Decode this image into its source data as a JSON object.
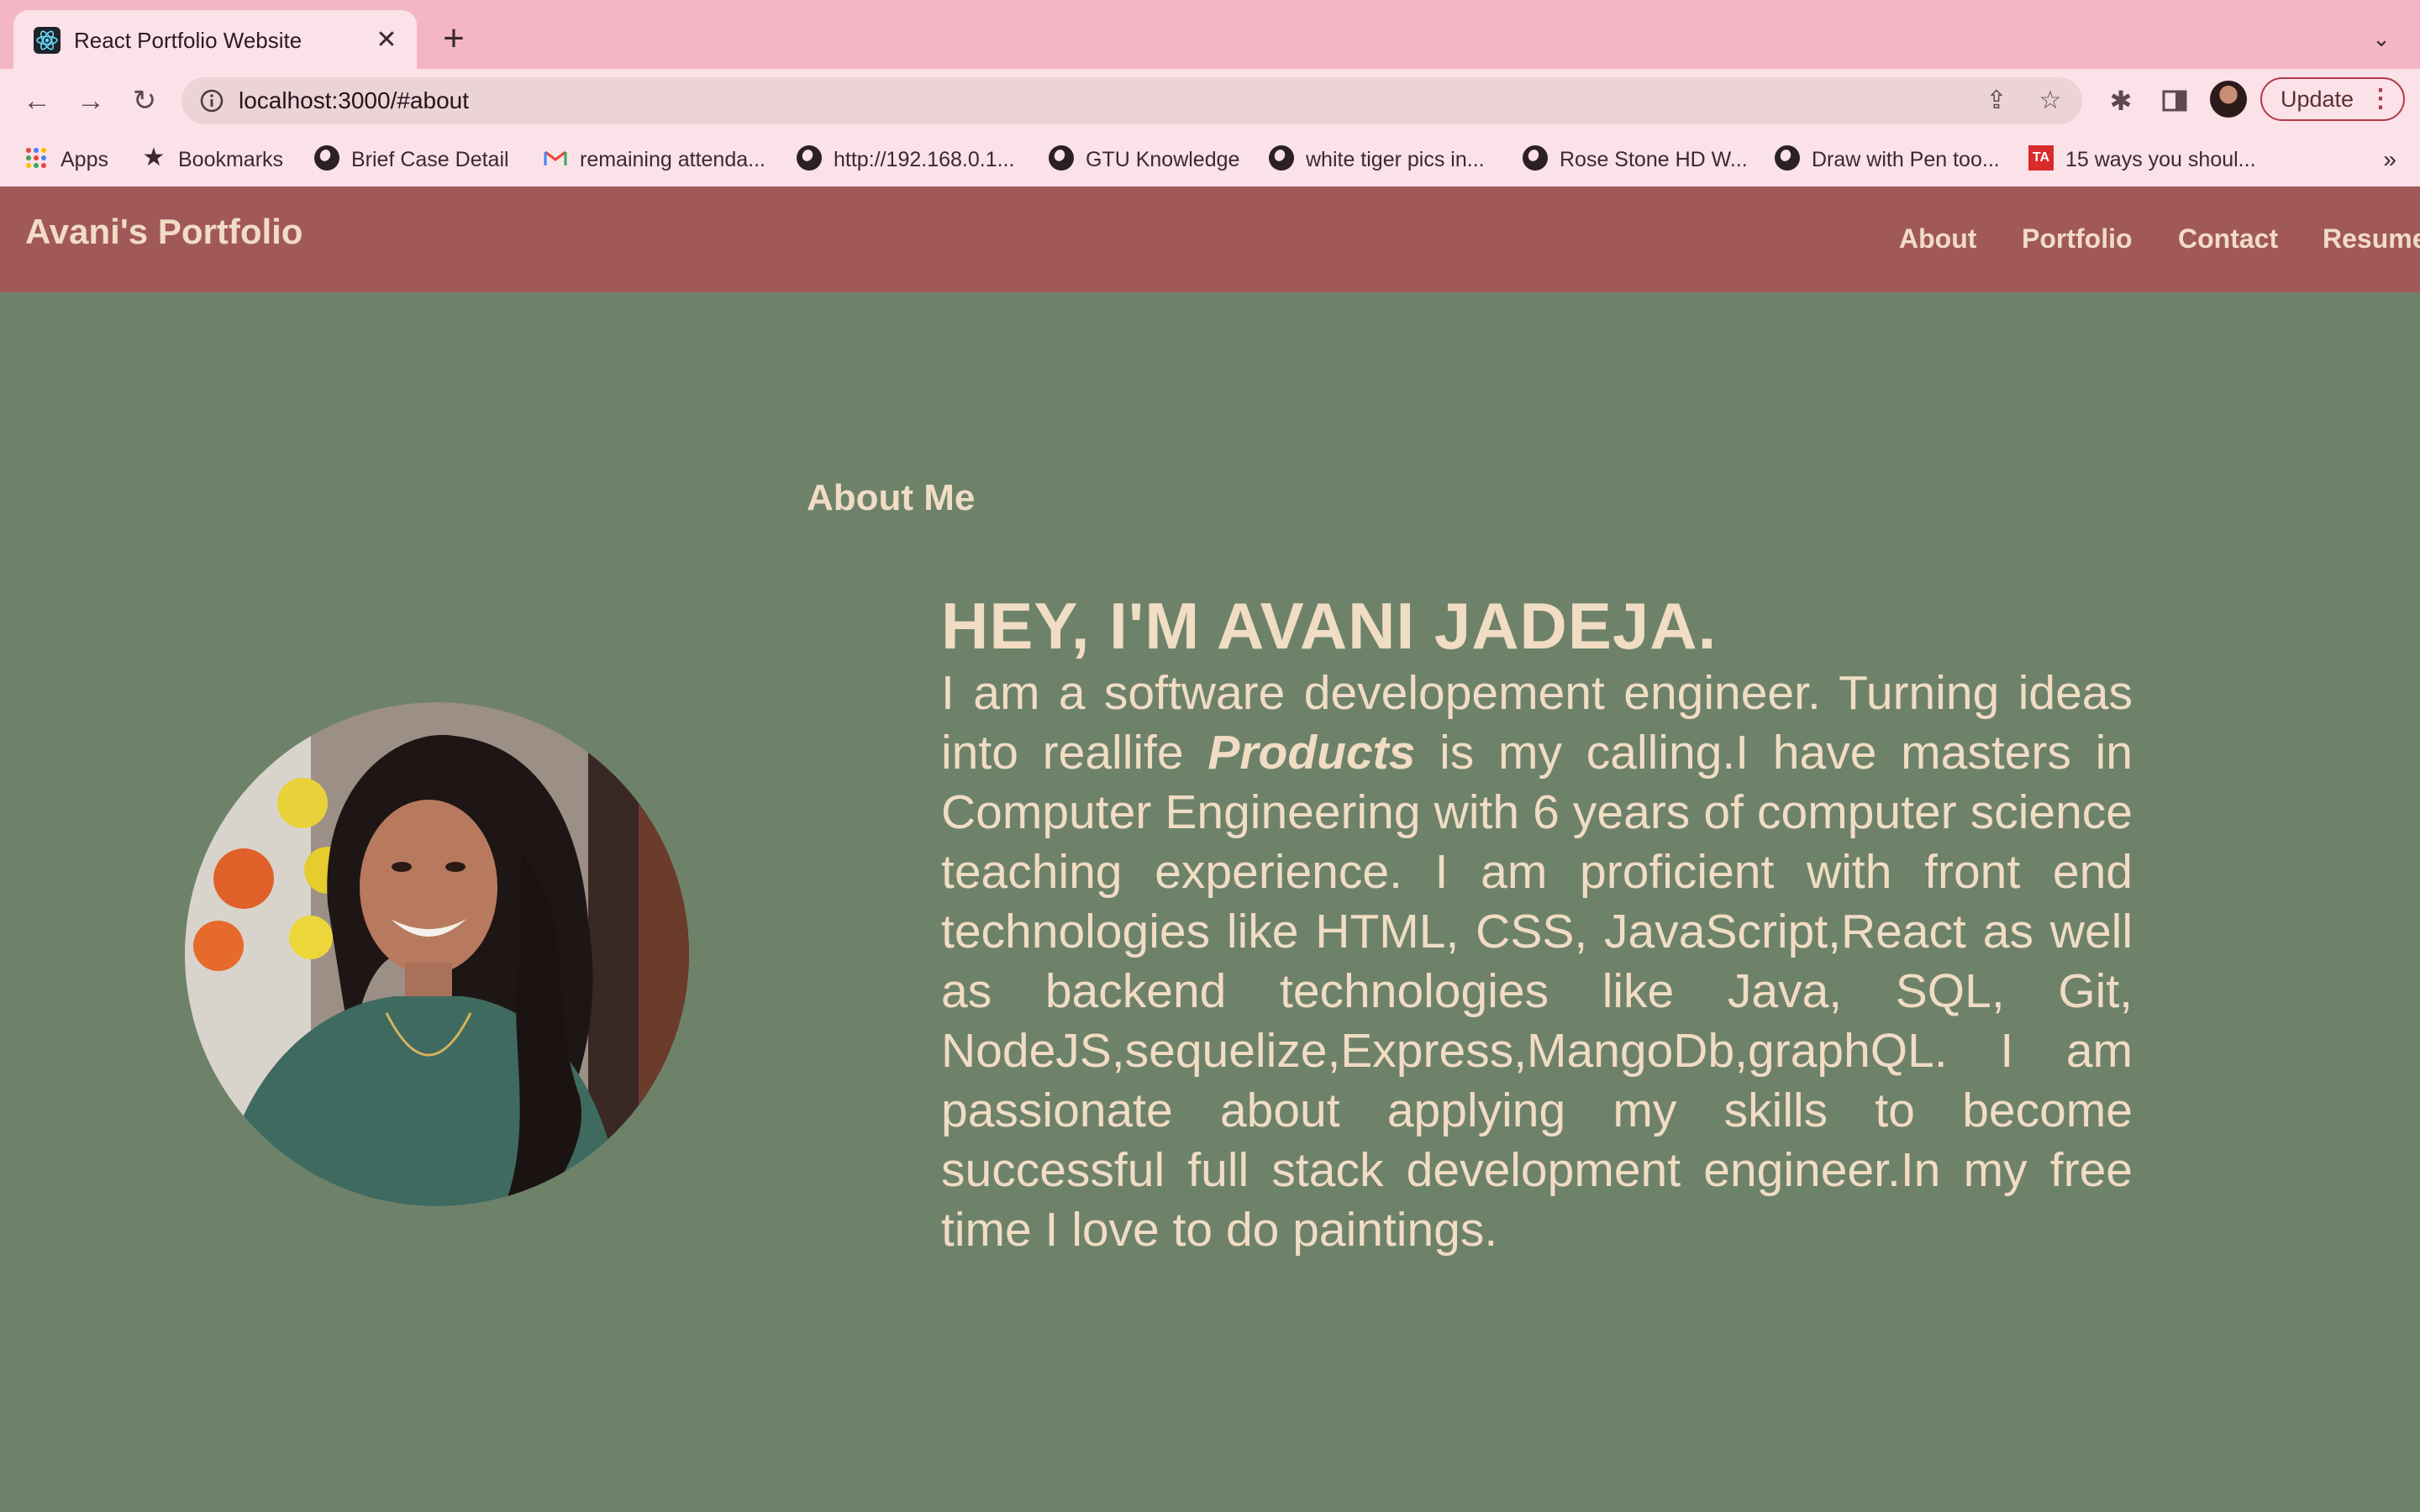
{
  "browser": {
    "tab": {
      "title": "React Portfolio Website",
      "close": "✕"
    },
    "new_tab": "+",
    "tab_menu": "⌄",
    "address": {
      "url": "localhost:3000/#about"
    },
    "update_label": "Update",
    "bookmarks": [
      {
        "label": "Apps",
        "icon": "apps-grid-icon"
      },
      {
        "label": "Bookmarks",
        "icon": "star-icon"
      },
      {
        "label": "Brief Case Detail",
        "icon": "globe-icon"
      },
      {
        "label": "remaining attenda...",
        "icon": "gmail-icon"
      },
      {
        "label": "http://192.168.0.1...",
        "icon": "globe-icon"
      },
      {
        "label": "GTU Knowledge",
        "icon": "globe-icon"
      },
      {
        "label": "white tiger pics in...",
        "icon": "globe-icon"
      },
      {
        "label": "Rose Stone HD W...",
        "icon": "globe-icon"
      },
      {
        "label": "Draw with Pen too...",
        "icon": "globe-icon"
      },
      {
        "label": "15 ways you shoul...",
        "icon": "ta-icon"
      }
    ],
    "bookmarks_overflow": "»"
  },
  "site": {
    "brand": "Avani's Portfolio",
    "nav": [
      "About",
      "Portfolio",
      "Contact",
      "Resume"
    ],
    "colors": {
      "header": "#a15859",
      "background": "#6e826a",
      "text": "#f1dcc4"
    }
  },
  "about": {
    "section_title": "About Me",
    "headline": "HEY, I'M AVANI JADEJA.",
    "bio_before": "I am a software developement engineer. Turning ideas into reallife ",
    "bio_emphasis": "Products",
    "bio_after": " is my calling.I have masters in Computer Engineering with 6 years of computer science teaching experience. I am proficient with front end technologies like HTML, CSS, JavaScript,React as well as backend technologies like Java, SQL, Git, NodeJS,sequelize,Express,MangoDb,graphQL.  I am passionate about applying my skills to become successful full stack development engineer.In my free time I love to do paintings."
  }
}
